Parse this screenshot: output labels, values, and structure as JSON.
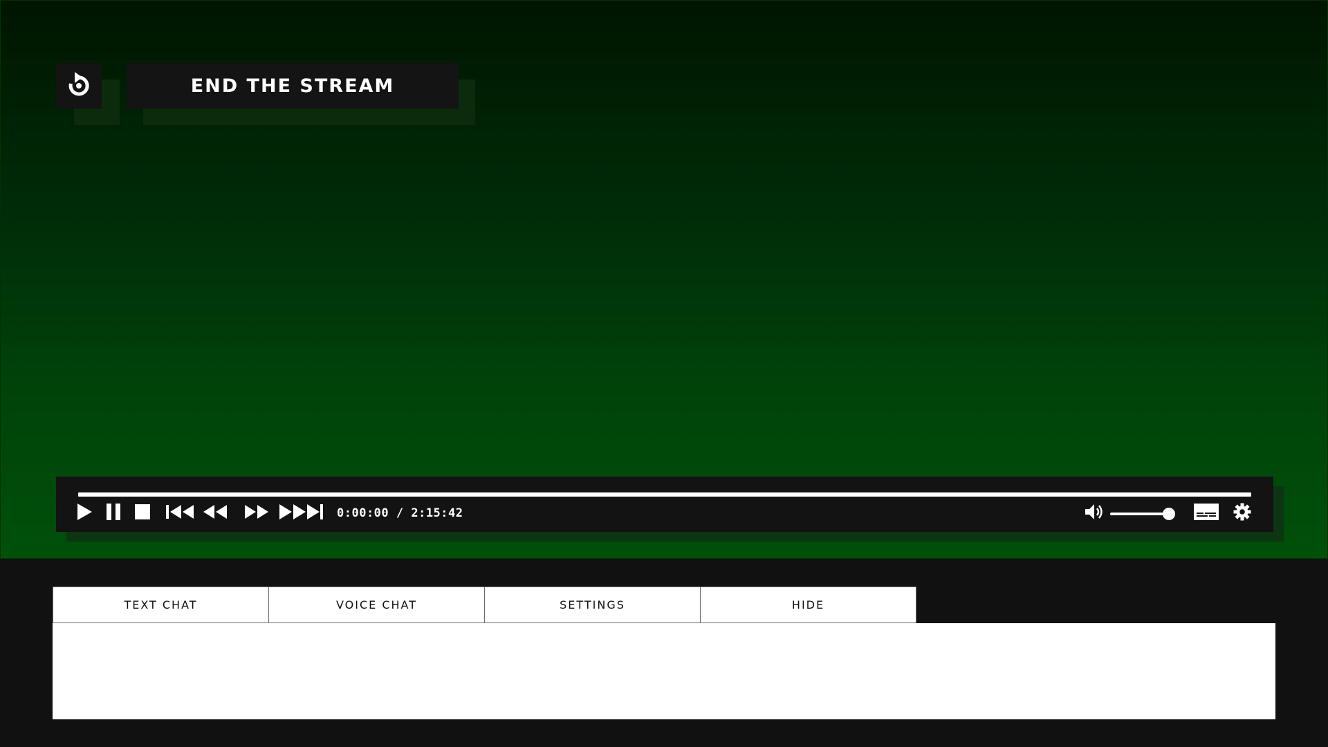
{
  "top": {
    "replay_icon": "replay-icon",
    "end_stream_label": "END THE STREAM"
  },
  "player": {
    "progress": 0.0,
    "time_display": "0:00:00 / 2:15:42",
    "volume": 0.92,
    "icons": [
      "play-icon",
      "pause-icon",
      "stop-icon",
      "skip-back-icon",
      "rewind-icon",
      "fast-forward-icon",
      "skip-forward-icon",
      "volume-icon",
      "subtitles-icon",
      "settings-gear-icon"
    ]
  },
  "tabs": [
    {
      "label": "TEXT CHAT"
    },
    {
      "label": "VOICE CHAT"
    },
    {
      "label": "SETTINGS"
    },
    {
      "label": "HIDE"
    }
  ],
  "colors": {
    "stage_top": "#001500",
    "stage_bottom": "#005009",
    "panel_dark": "#131313",
    "bottom_bar": "#111111"
  }
}
